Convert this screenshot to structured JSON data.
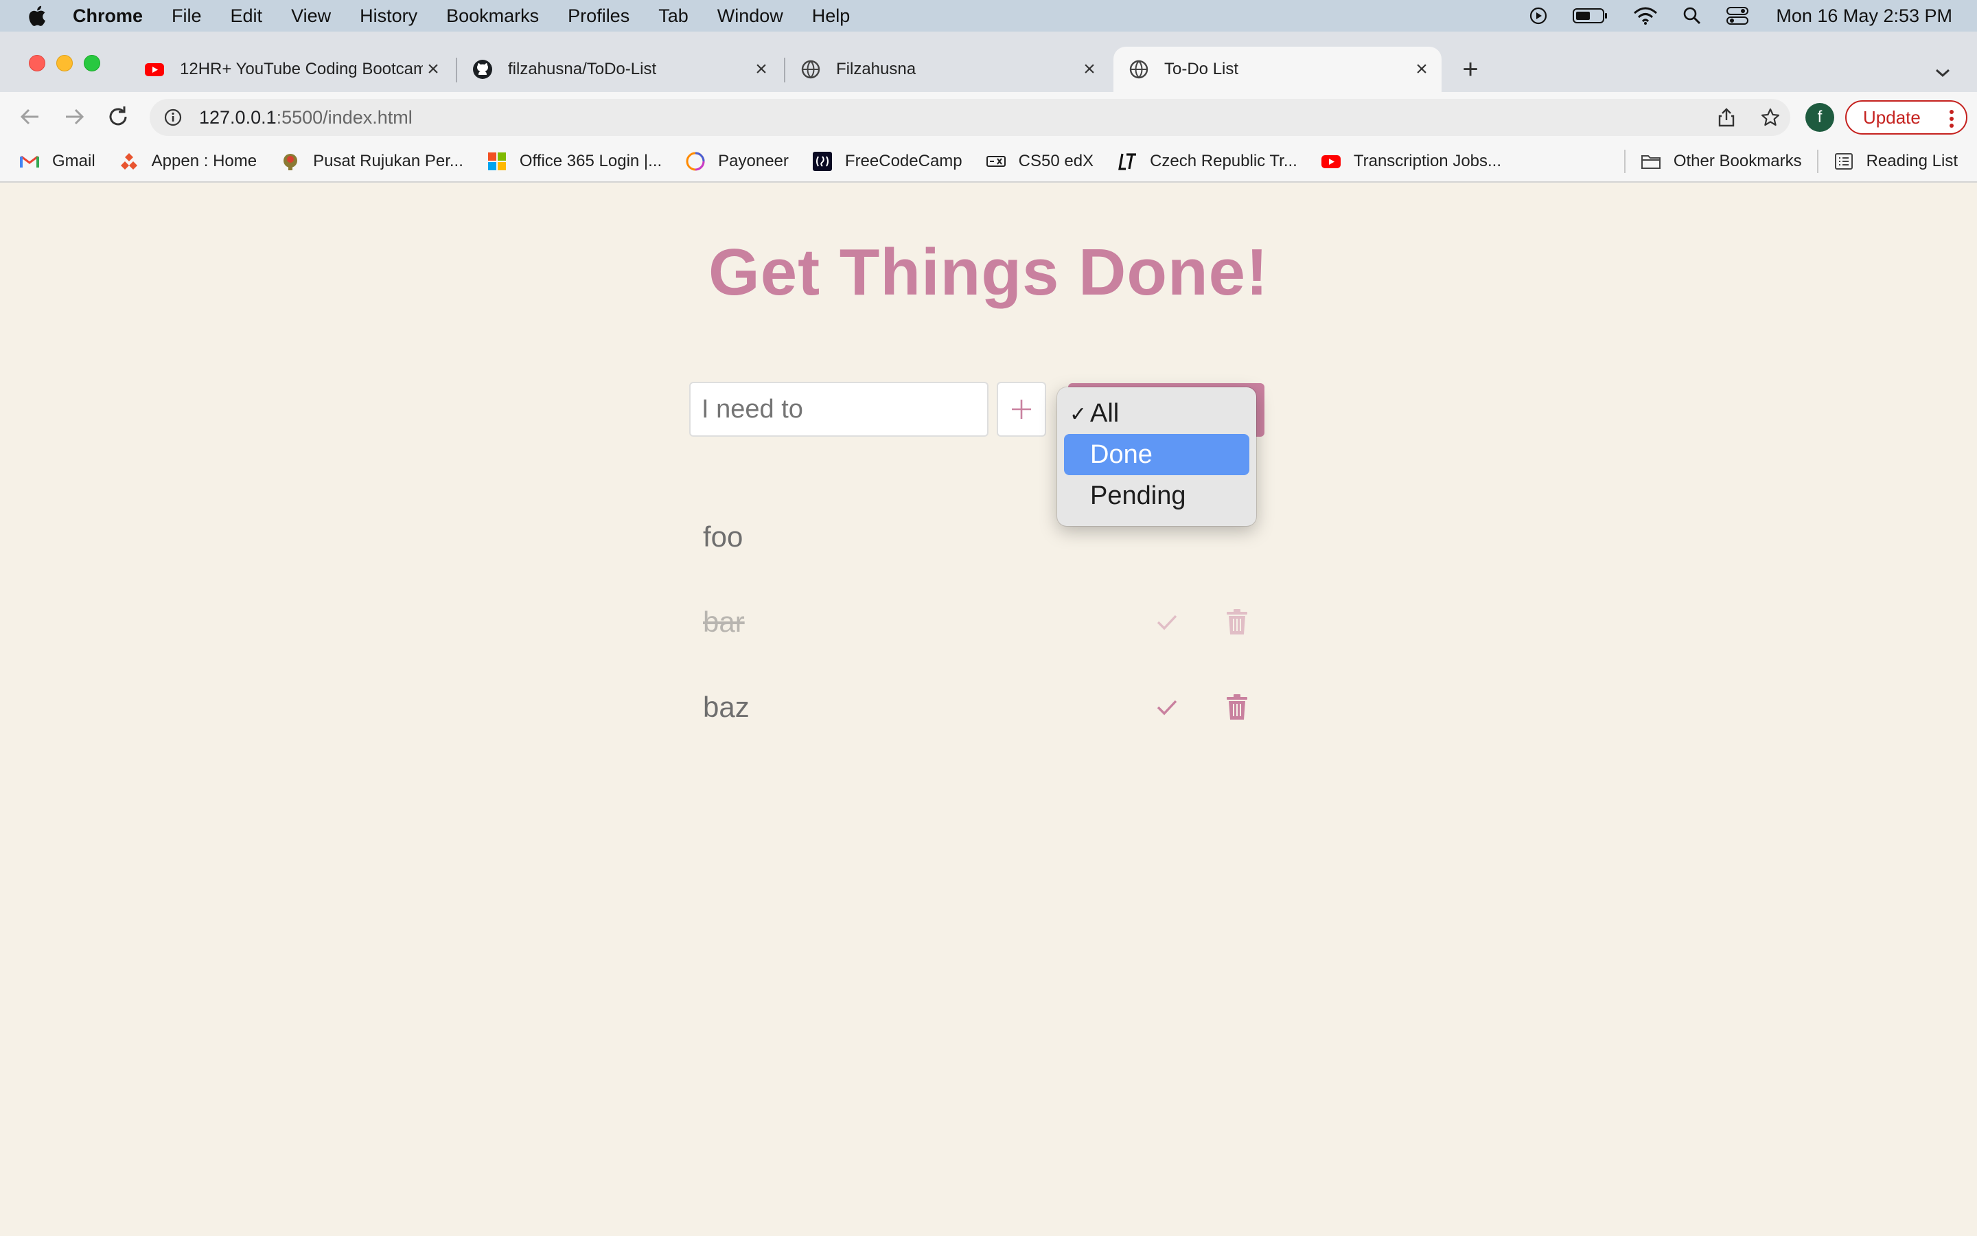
{
  "menubar": {
    "app": "Chrome",
    "items": [
      "File",
      "Edit",
      "View",
      "History",
      "Bookmarks",
      "Profiles",
      "Tab",
      "Window",
      "Help"
    ],
    "clock": "Mon 16 May  2:53 PM"
  },
  "tabs": [
    {
      "title": "12HR+ YouTube Coding Bootcamp",
      "icon": "youtube-icon"
    },
    {
      "title": "filzahusna/ToDo-List",
      "icon": "github-icon"
    },
    {
      "title": "Filzahusna",
      "icon": "globe-icon"
    },
    {
      "title": "To-Do List",
      "icon": "globe-icon",
      "active": true
    }
  ],
  "address": {
    "host": "127.0.0.1",
    "rest": ":5500/index.html"
  },
  "profile": {
    "initial": "f"
  },
  "update_label": "Update",
  "bookmarks": [
    {
      "label": "Gmail",
      "icon": "gmail-icon"
    },
    {
      "label": "Appen : Home",
      "icon": "appen-icon"
    },
    {
      "label": "Pusat Rujukan Per...",
      "icon": "pusat-icon"
    },
    {
      "label": "Office 365 Login |...",
      "icon": "microsoft-icon"
    },
    {
      "label": "Payoneer",
      "icon": "payoneer-icon"
    },
    {
      "label": "FreeCodeCamp",
      "icon": "freecodecamp-icon"
    },
    {
      "label": "CS50 edX",
      "icon": "edx-icon"
    },
    {
      "label": "Czech Republic Tr...",
      "icon": "lt-icon"
    },
    {
      "label": "Transcription Jobs...",
      "icon": "youtube-icon"
    }
  ],
  "bookmarks_right": {
    "other": "Other Bookmarks",
    "reading": "Reading List"
  },
  "app": {
    "heading": "Get Things Done!",
    "input_placeholder": "I need to",
    "todos": [
      {
        "text": "foo",
        "done": false
      },
      {
        "text": "bar",
        "done": true
      },
      {
        "text": "baz",
        "done": false
      }
    ],
    "filter": {
      "options": [
        "All",
        "Done",
        "Pending"
      ],
      "selected": "All",
      "highlighted": "Done"
    }
  },
  "colors": {
    "accent": "#c9819f",
    "page_bg": "#f6f1e7",
    "highlight": "#5f97f5"
  }
}
